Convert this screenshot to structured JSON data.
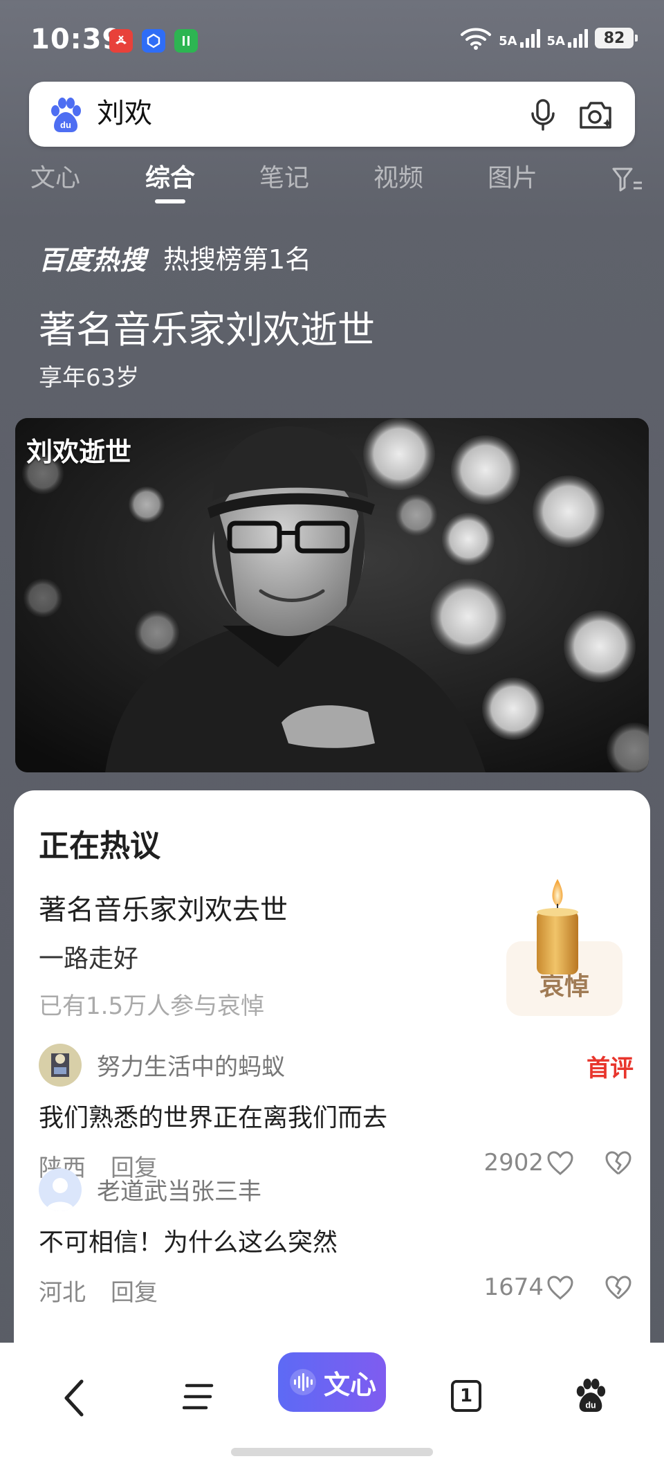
{
  "status_bar": {
    "time": "10:39",
    "network_1": "5A",
    "network_2": "5A",
    "battery": "82",
    "app_badges": [
      {
        "icon": "missed-call-icon",
        "color": "#e8413a"
      },
      {
        "icon": "blue-app-icon",
        "color": "#2f6df6"
      },
      {
        "icon": "green-app-icon",
        "color": "#2db552"
      }
    ]
  },
  "search": {
    "query": "刘欢"
  },
  "tabs": [
    {
      "label": "文心"
    },
    {
      "label": "综合",
      "active": true
    },
    {
      "label": "笔记"
    },
    {
      "label": "视频"
    },
    {
      "label": "图片"
    }
  ],
  "hot": {
    "brand": "百度热搜",
    "rank": "热搜榜第1名",
    "headline": "著名音乐家刘欢逝世",
    "subline": "享年63岁"
  },
  "photo": {
    "caption": "刘欢逝世"
  },
  "discussion": {
    "title": "正在热议",
    "topic_title": "著名音乐家刘欢去世",
    "topic_sub": "一路走好",
    "participants": "已有1.5万人参与哀悼",
    "mourn_label": "哀悼",
    "comments": [
      {
        "name": "努力生活中的蚂蚁",
        "badge": "首评",
        "text": "我们熟悉的世界正在离我们而去",
        "location": "陕西",
        "reply": "回复",
        "likes": "2902"
      },
      {
        "name": "老道武当张三丰",
        "badge": "",
        "text": "不可相信！为什么这么突然",
        "location": "河北",
        "reply": "回复",
        "likes": "1674"
      }
    ]
  },
  "bottom_nav": {
    "wenxin_label": "文心",
    "tab_count": "1"
  },
  "colors": {
    "accent": "#e8352c",
    "wenxin_gradient_start": "#5d6af5",
    "wenxin_gradient_end": "#7f5cf0"
  }
}
